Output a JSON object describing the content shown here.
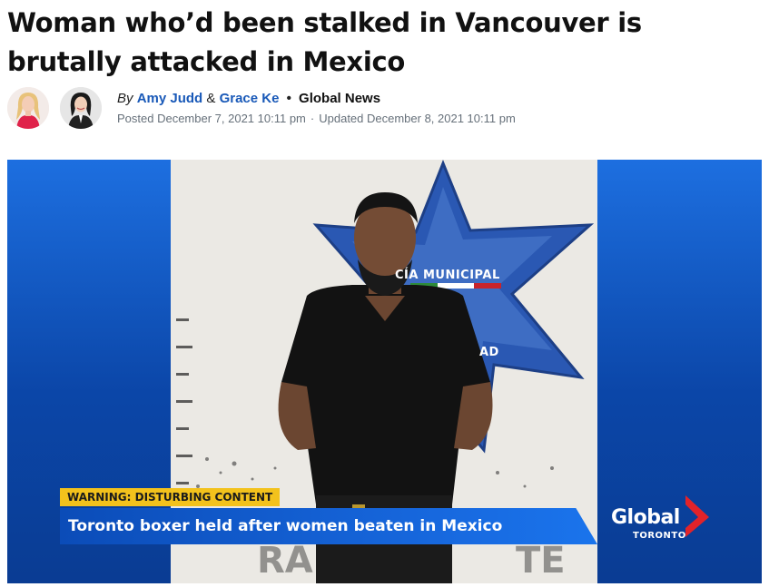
{
  "article": {
    "headline": "Woman who’d been stalked in Vancouver is brutally attacked in Mexico",
    "byline": {
      "by": "By",
      "authors": [
        "Amy Judd",
        "Grace Ke"
      ],
      "joiner": "&",
      "separator": "•",
      "outlet": "Global News",
      "posted": "Posted December 7, 2021 10:11 pm",
      "date_separator": "·",
      "updated": "Updated December 8, 2021 10:11 pm"
    }
  },
  "media": {
    "badge_text_1": "CÍA MUNICIPAL",
    "badge_text_2": "AD",
    "warning": "WARNING: DISTURBING CONTENT",
    "caption": "Toronto boxer held after women beaten in Mexico",
    "logo_word": "Global",
    "logo_city": "TORONTO"
  },
  "colors": {
    "author_link": "#1959b8",
    "warning_bg": "#f3c21c",
    "lower_third": "#1768de",
    "brand_red": "#e2232a"
  },
  "icons": [
    "author-avatar",
    "global-logo-icon"
  ]
}
